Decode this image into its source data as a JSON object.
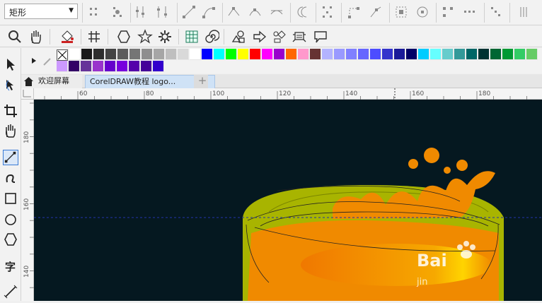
{
  "property_bar": {
    "shape_select_value": "矩形"
  },
  "tabs": {
    "welcome_label": "欢迎屏幕",
    "document_label": "CorelDRAW教程 logo...",
    "add_label": "+"
  },
  "rulers": {
    "horizontal_labels": [
      "60",
      "80",
      "100",
      "120",
      "140",
      "160",
      "180"
    ],
    "vertical_labels": [
      "180",
      "160",
      "140"
    ]
  },
  "watermark": {
    "brand": "Bai",
    "sub": "jin"
  },
  "palette": {
    "row1": [
      "#ffffff",
      "#1a1a1a",
      "#2e2e2e",
      "#444444",
      "#5c5c5c",
      "#757575",
      "#8e8e8e",
      "#a6a6a6",
      "#bfbfbf",
      "#d9d9d9",
      "#ffffff",
      "#0000ff",
      "#00ffff",
      "#00ff00",
      "#ffff00",
      "#ff0000",
      "#ff00ff",
      "#9900cc",
      "#ff6600",
      "#ff99cc",
      "#663333",
      "#b3b3ff",
      "#9999ff",
      "#8080ff",
      "#6666ff",
      "#4d4dff",
      "#3333cc",
      "#1a1a99",
      "#000066",
      "#00ccff",
      "#66ffff",
      "#66cccc",
      "#339999",
      "#006666",
      "#003333",
      "#006633",
      "#009933",
      "#33cc66",
      "#66cc66"
    ],
    "row2": [
      "#cc99ff",
      "#330066",
      "#663399",
      "#9933cc",
      "#6600cc",
      "#7700dd",
      "#5500aa",
      "#440099",
      "#3300cc"
    ]
  },
  "colors": {
    "canvas_bg": "#051820",
    "bowl_green": "#a8b400",
    "juice_orange": "#f08a00",
    "guideline": "#2233aa"
  }
}
